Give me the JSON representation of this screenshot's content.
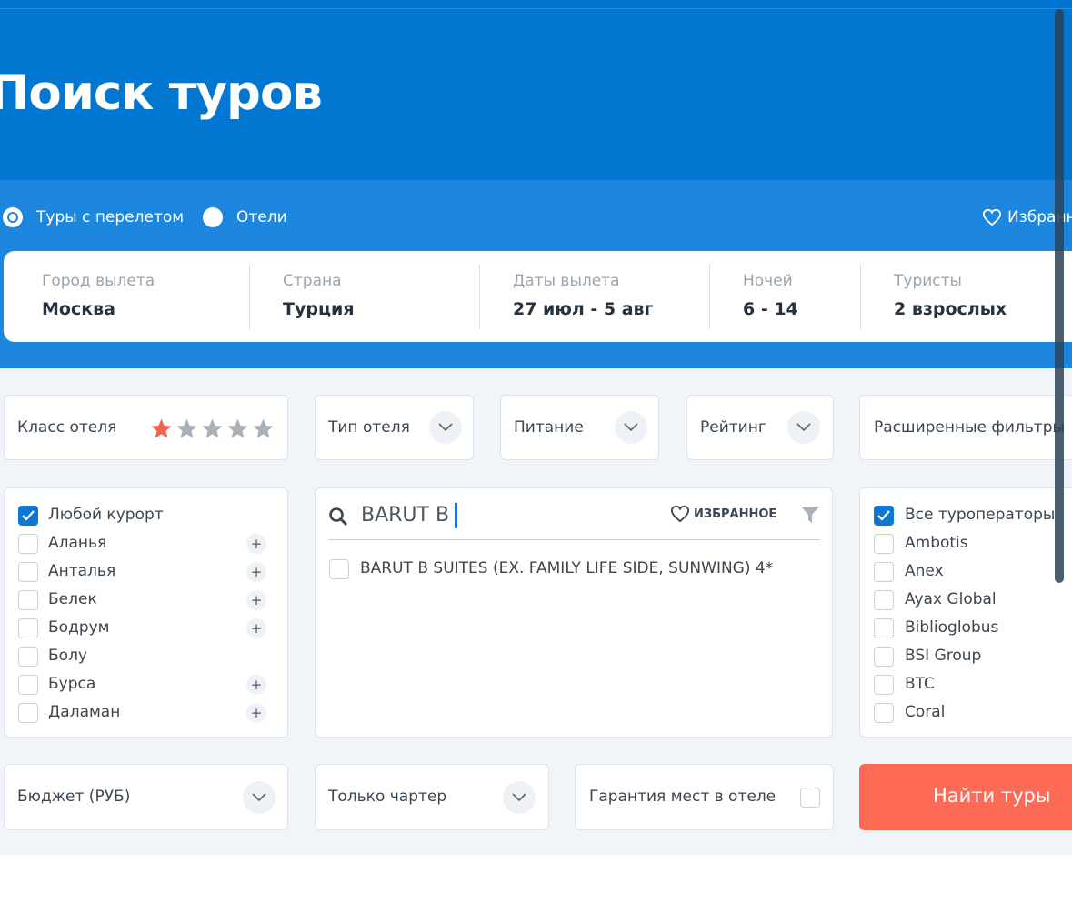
{
  "header": {
    "title": "Поиск туров"
  },
  "mode": {
    "options": [
      {
        "label": "Туры с перелетом",
        "selected": true
      },
      {
        "label": "Отели",
        "selected": false
      }
    ],
    "favorites_label": "Избранное"
  },
  "search": {
    "fields": [
      {
        "label": "Город вылета",
        "value": "Москва"
      },
      {
        "label": "Страна",
        "value": "Турция"
      },
      {
        "label": "Даты вылета",
        "value": "27 июл - 5 авг"
      },
      {
        "label": "Ночей",
        "value": "6 - 14"
      },
      {
        "label": "Туристы",
        "value": "2 взрослых"
      }
    ]
  },
  "filters": {
    "hotel_class": {
      "label": "Класс отеля",
      "stars_selected": 1,
      "stars_total": 5,
      "star_on_color": "#f2634f",
      "star_off_color": "#a9b0b8"
    },
    "hotel_type": {
      "label": "Тип отеля"
    },
    "meal": {
      "label": "Питание"
    },
    "rating": {
      "label": "Рейтинг"
    },
    "advanced": {
      "label": "Расширенные фильтры"
    }
  },
  "resorts": {
    "items": [
      {
        "label": "Любой курорт",
        "checked": true,
        "expandable": false
      },
      {
        "label": "Аланья",
        "checked": false,
        "expandable": true
      },
      {
        "label": "Анталья",
        "checked": false,
        "expandable": true
      },
      {
        "label": "Белек",
        "checked": false,
        "expandable": true
      },
      {
        "label": "Бодрум",
        "checked": false,
        "expandable": true
      },
      {
        "label": "Болу",
        "checked": false,
        "expandable": false
      },
      {
        "label": "Бурса",
        "checked": false,
        "expandable": true
      },
      {
        "label": "Даламан",
        "checked": false,
        "expandable": true
      }
    ],
    "plus_symbol": "+"
  },
  "hotel_search": {
    "query": "BARUT B",
    "favorites_label": "ИЗБРАННОЕ",
    "results": [
      {
        "label": "BARUT B SUITES (EX. FAMILY LIFE SIDE, SUNWING) 4*",
        "checked": false
      }
    ]
  },
  "operators": {
    "items": [
      {
        "label": "Все туроператоры",
        "checked": true
      },
      {
        "label": "Ambotis",
        "checked": false
      },
      {
        "label": "Anex",
        "checked": false
      },
      {
        "label": "Ayax Global",
        "checked": false
      },
      {
        "label": "Biblioglobus",
        "checked": false
      },
      {
        "label": "BSI Group",
        "checked": false
      },
      {
        "label": "BTC",
        "checked": false
      },
      {
        "label": "Coral",
        "checked": false
      }
    ]
  },
  "bottom": {
    "budget_label": "Бюджет (РУБ)",
    "charter_label": "Только чартер",
    "guarantee_label": "Гарантия мест в отеле",
    "find_label": "Найти туры"
  },
  "colors": {
    "primary": "#0277d1",
    "band": "#1d87e0",
    "accent": "#fd6b57",
    "checkbox": "#0d77d4"
  }
}
